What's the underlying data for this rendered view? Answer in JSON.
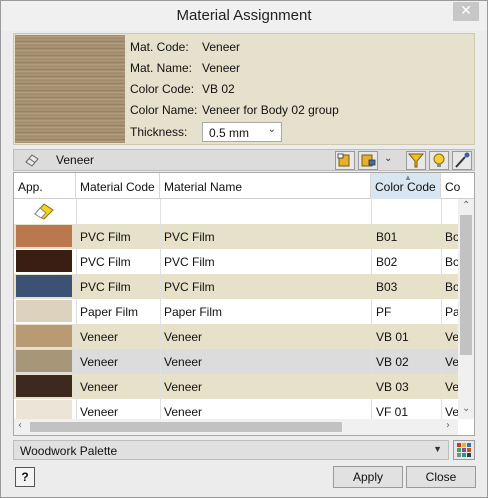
{
  "window": {
    "title": "Material Assignment",
    "close_glyph": "✕"
  },
  "info": {
    "mat_code_label": "Mat. Code:",
    "mat_code": "Veneer",
    "mat_name_label": "Mat. Name:",
    "mat_name": "Veneer",
    "color_code_label": "Color Code:",
    "color_code": "VB 02",
    "color_name_label": "Color Name:",
    "color_name": "Veneer for Body 02 group",
    "thickness_label": "Thickness:",
    "thickness": "0.5 mm"
  },
  "toolbar": {
    "filter_label": "Veneer",
    "icons": [
      "eraser-icon",
      "assign-icon",
      "assign-dropdown-icon",
      "filter-icon",
      "bulb-icon",
      "eyedropper-icon"
    ]
  },
  "table": {
    "columns": [
      "App.",
      "Material Code",
      "Material Name",
      "Color Code",
      "Co"
    ],
    "sorted_column": "Color Code",
    "rows": [
      {
        "swatch": "eraser",
        "mat_code": "",
        "mat_name": "",
        "color_code": "",
        "co": ""
      },
      {
        "swatch": "#b9784e",
        "mat_code": "PVC Film",
        "mat_name": "PVC Film",
        "color_code": "B01",
        "co": "Bo"
      },
      {
        "swatch": "#3a1e14",
        "mat_code": "PVC Film",
        "mat_name": "PVC Film",
        "color_code": "B02",
        "co": "Bo"
      },
      {
        "swatch": "#3b5275",
        "mat_code": "PVC Film",
        "mat_name": "PVC Film",
        "color_code": "B03",
        "co": "Bo"
      },
      {
        "swatch": "#ddd2be",
        "mat_code": "Paper Film",
        "mat_name": "Paper Film",
        "color_code": "PF",
        "co": "Pa"
      },
      {
        "swatch": "#b89a74",
        "mat_code": "Veneer",
        "mat_name": "Veneer",
        "color_code": "VB 01",
        "co": "Ve"
      },
      {
        "swatch": "#a89678",
        "mat_code": "Veneer",
        "mat_name": "Veneer",
        "color_code": "VB 02",
        "co": "Ve"
      },
      {
        "swatch": "#3c2a1e",
        "mat_code": "Veneer",
        "mat_name": "Veneer",
        "color_code": "VB 03",
        "co": "Ve"
      },
      {
        "swatch": "#ece4d6",
        "mat_code": "Veneer",
        "mat_name": "Veneer",
        "color_code": "VF 01",
        "co": "Ve"
      }
    ]
  },
  "palette": {
    "selected": "Woodwork Palette"
  },
  "buttons": {
    "help": "?",
    "apply": "Apply",
    "close": "Close"
  },
  "colors": {
    "row_alt": "#e8e1c9",
    "info_bg": "#e6e1cd",
    "selected_row": "#dcdcdc"
  }
}
